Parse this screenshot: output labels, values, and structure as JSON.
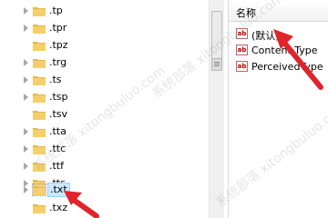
{
  "tree": {
    "items": [
      {
        "label": ".tp"
      },
      {
        "label": ".tpr"
      },
      {
        "label": ".tpz"
      },
      {
        "label": ".trg"
      },
      {
        "label": ".ts"
      },
      {
        "label": ".tsp"
      },
      {
        "label": ".tsv"
      },
      {
        "label": ".tta"
      },
      {
        "label": ".ttc"
      },
      {
        "label": ".ttf"
      },
      {
        "label": ".tts"
      },
      {
        "label": ".txt",
        "selected": true
      },
      {
        "label": ".txz"
      }
    ]
  },
  "values": {
    "column_header": "名称",
    "rows": [
      {
        "icon": "ab",
        "name": "(默认)"
      },
      {
        "icon": "ab",
        "name": "Content Type"
      },
      {
        "icon": "ab",
        "name": "PerceivedType"
      }
    ]
  },
  "watermark": {
    "lines": [
      "系统部落 xitongbuluo.com",
      "系统部落 xitongbuluo.com",
      "系统部落 xitongbuluo.com"
    ]
  },
  "colors": {
    "selection": "#cce8ff",
    "folder": "#e8b84a",
    "arrow": "#e0242a"
  }
}
